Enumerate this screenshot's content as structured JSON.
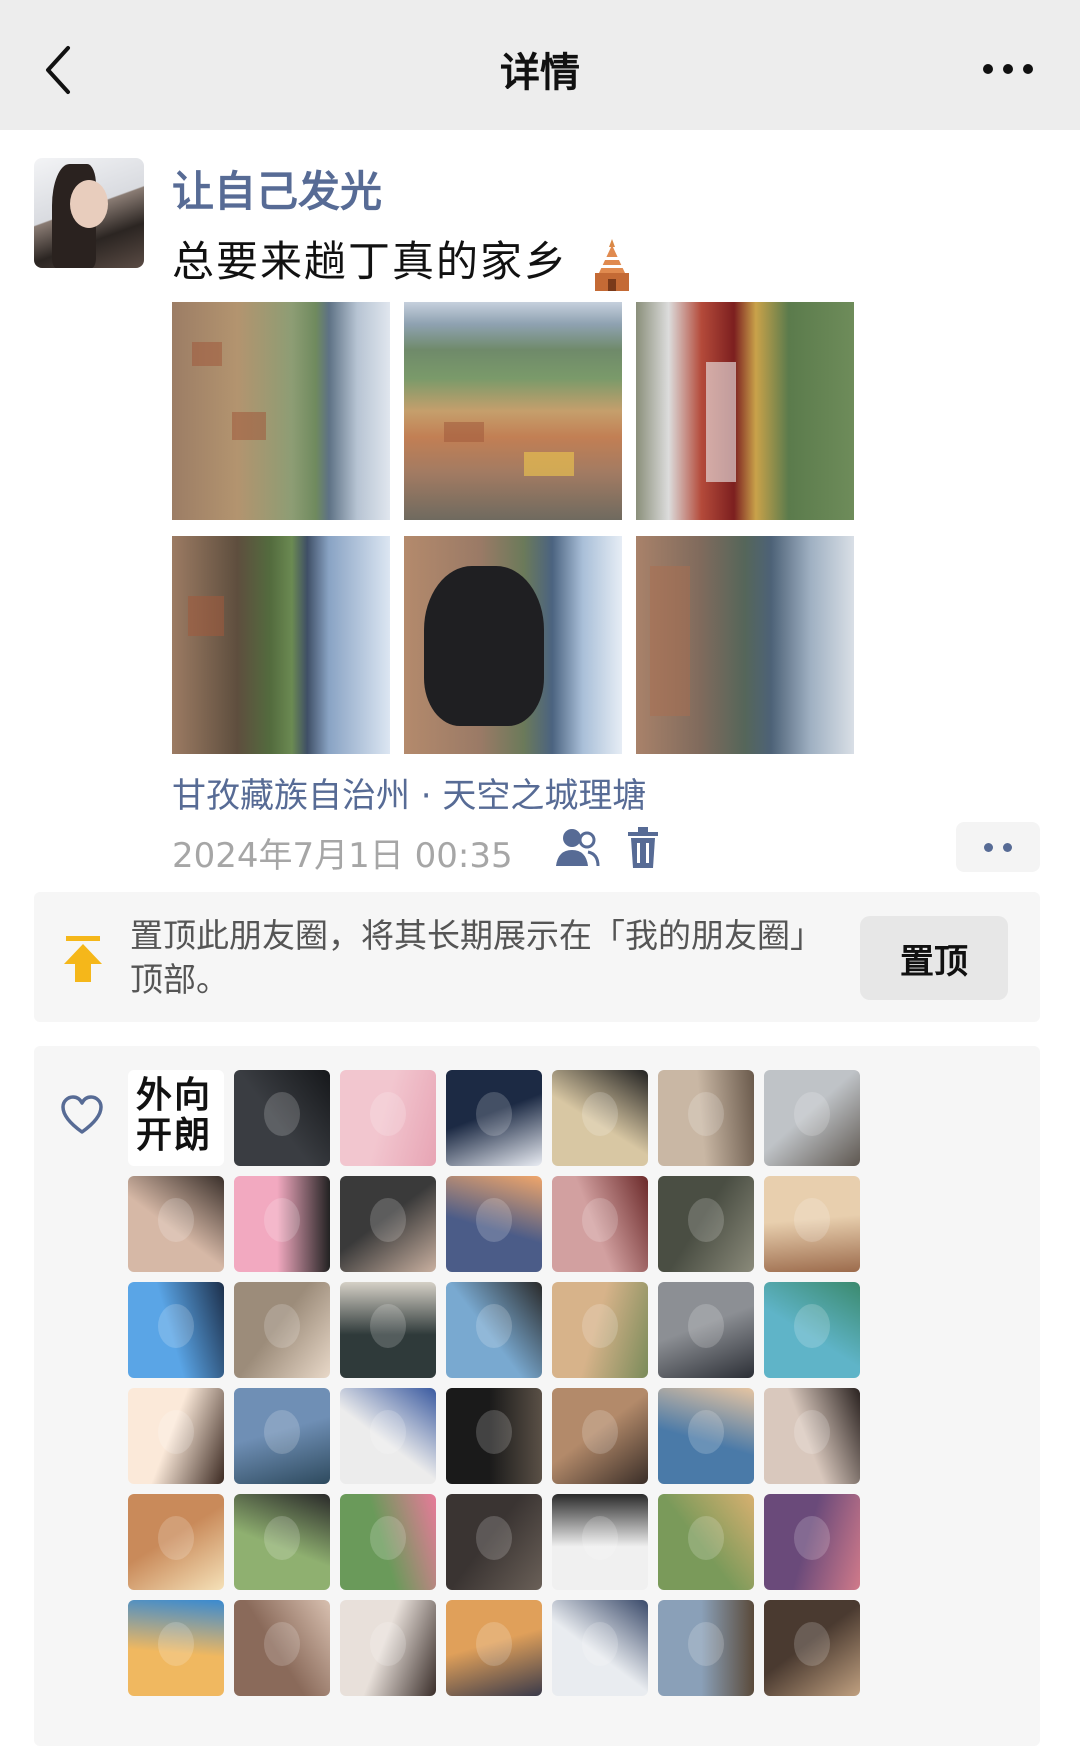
{
  "nav": {
    "title": "详情"
  },
  "post": {
    "username": "让自己发光",
    "text": "总要来趟丁真的家乡",
    "emoji": "pagoda-emoji",
    "photos": [
      {
        "name": "photo-1"
      },
      {
        "name": "photo-2"
      },
      {
        "name": "photo-3"
      },
      {
        "name": "photo-4"
      },
      {
        "name": "photo-5"
      },
      {
        "name": "photo-6"
      }
    ],
    "location": "甘孜藏族自治州 · 天空之城理塘",
    "time": "2024年7月1日 00:35"
  },
  "pin": {
    "text": "置顶此朋友圈，将其长期展示在「我的朋友圈」顶部。",
    "button": "置顶"
  },
  "likes": {
    "first_avatar_text": "外向开朗",
    "count_visible": 42
  },
  "colors": {
    "link": "#576b95",
    "nav_bg": "#ededed",
    "pin_icon": "#f5b71a",
    "muted": "#a6a6a6"
  }
}
